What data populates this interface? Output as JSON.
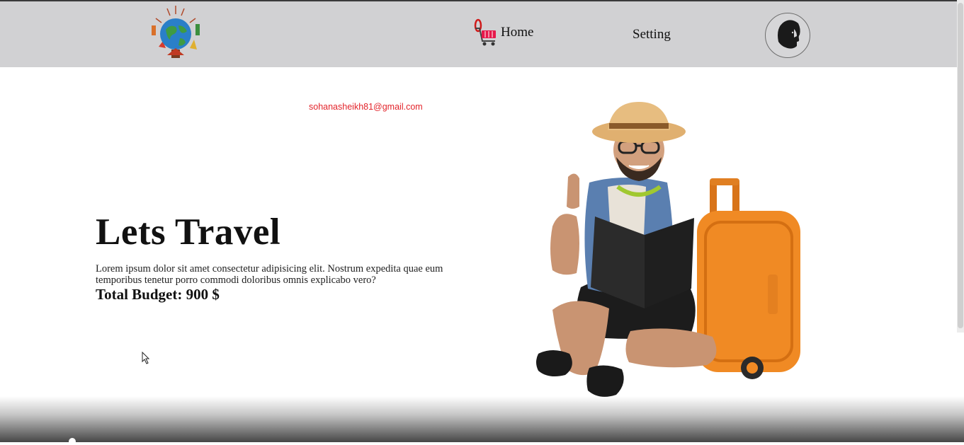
{
  "nav": {
    "home_label": "Home",
    "setting_label": "Setting"
  },
  "hero": {
    "email": "sohanasheikh81@gmail.com",
    "title": "Lets Travel",
    "description": "Lorem ipsum dolor sit amet consectetur adipisicing elit. Nostrum expedita quae eum temporibus tenetur porro commodi doloribus omnis explicabo vero?",
    "budget": "Total Budget: 900 $"
  },
  "colors": {
    "navbar_bg": "#d1d1d3",
    "email_text": "#e3242b",
    "suitcase": "#f08a24"
  },
  "icons": {
    "logo": "globe-logo-icon",
    "home": "shopping-cart-icon",
    "avatar": "bearded-man-avatar-icon"
  }
}
